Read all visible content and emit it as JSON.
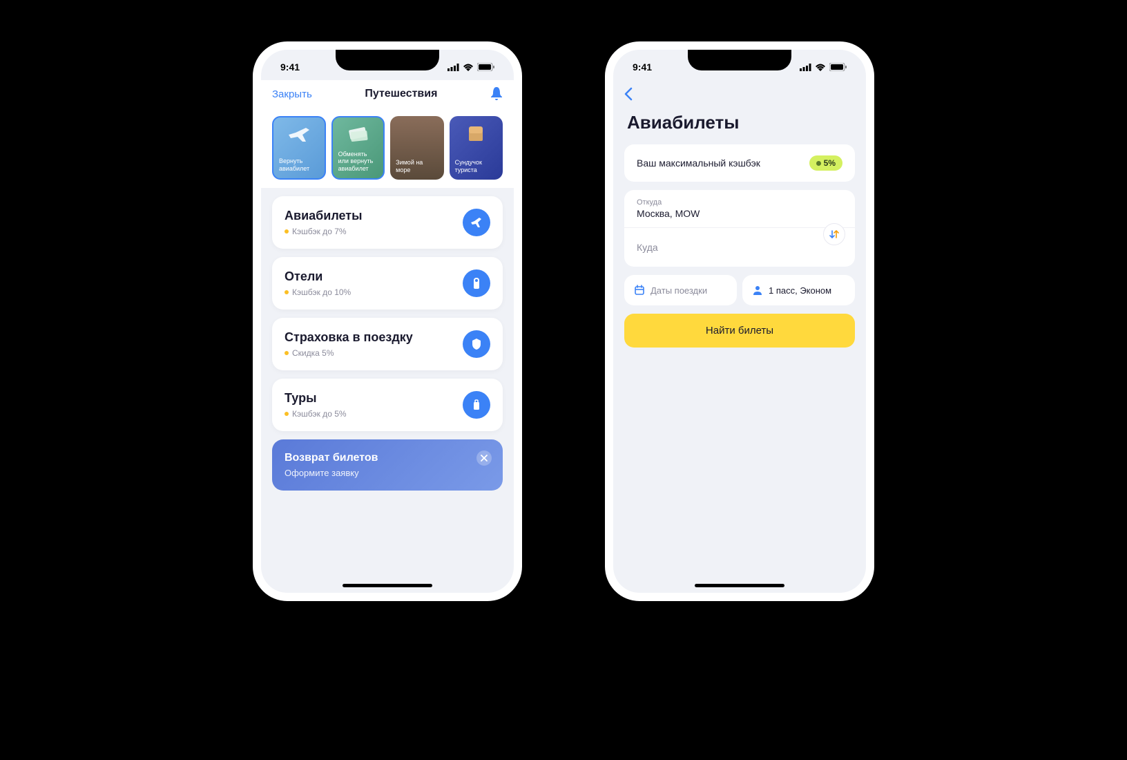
{
  "status": {
    "time": "9:41"
  },
  "screen1": {
    "nav": {
      "close": "Закрыть",
      "title": "Путешествия"
    },
    "stories": [
      {
        "label": "Вернуть авиабилет"
      },
      {
        "label": "Обменять или вернуть авиабилет"
      },
      {
        "label": "Зимой на море"
      },
      {
        "label": "Сундучок туриста"
      }
    ],
    "cards": [
      {
        "title": "Авиабилеты",
        "sub": "Кэшбэк до 7%"
      },
      {
        "title": "Отели",
        "sub": "Кэшбэк до 10%"
      },
      {
        "title": "Страховка в поездку",
        "sub": "Скидка 5%"
      },
      {
        "title": "Туры",
        "sub": "Кэшбэк до 5%"
      }
    ],
    "banner": {
      "title": "Возврат билетов",
      "sub": "Оформите заявку"
    }
  },
  "screen2": {
    "title": "Авиабилеты",
    "cashback": {
      "text": "Ваш максимальный кэшбэк",
      "value": "5%"
    },
    "from": {
      "label": "Откуда",
      "value": "Москва, MOW"
    },
    "to": {
      "placeholder": "Куда"
    },
    "dates": {
      "placeholder": "Даты поездки"
    },
    "pax": {
      "value": "1 пасс, Эконом"
    },
    "search": "Найти билеты"
  }
}
